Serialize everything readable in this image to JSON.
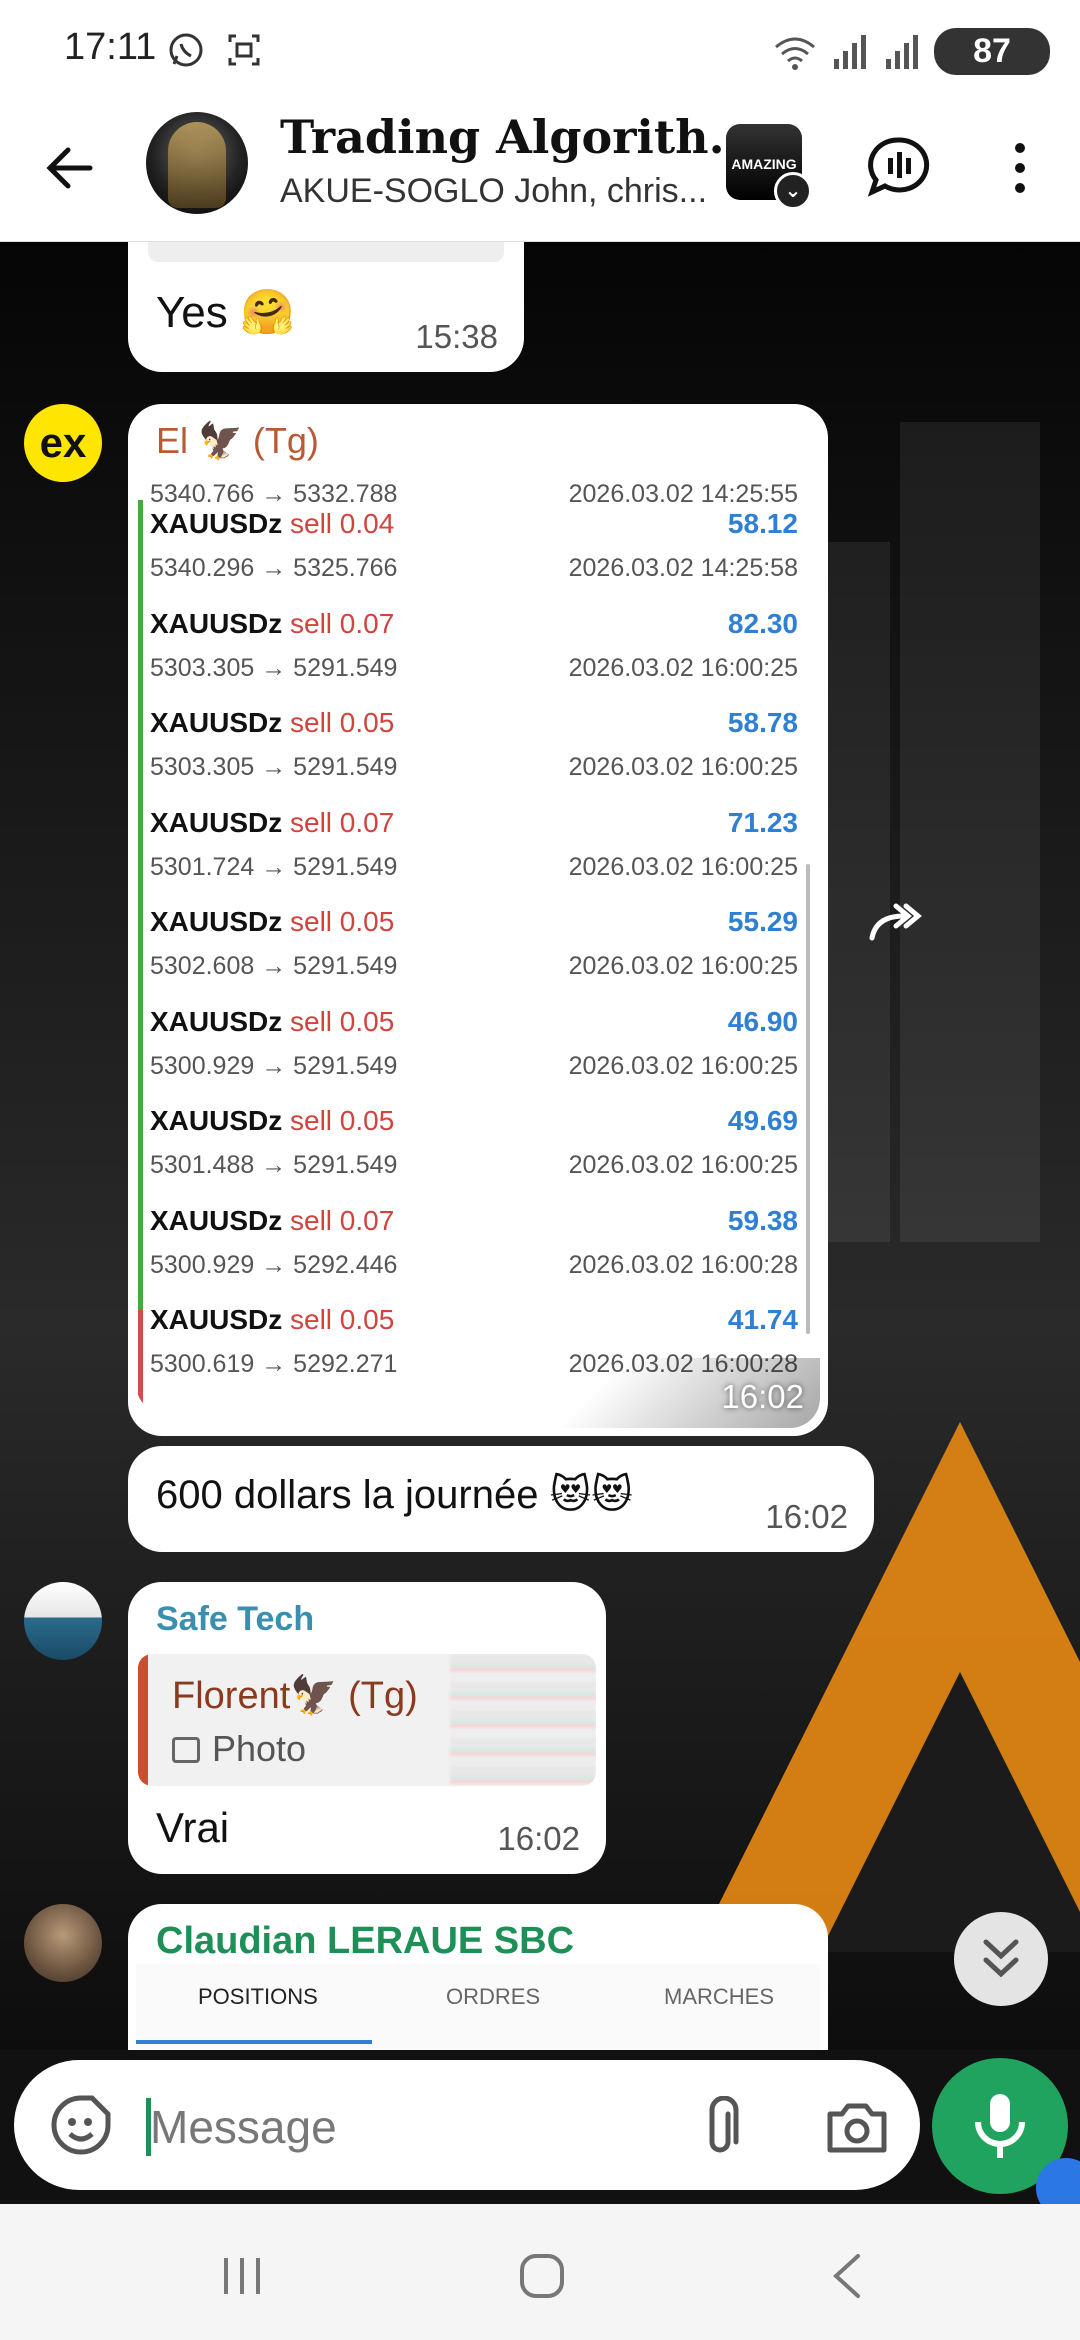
{
  "status_bar": {
    "time": "17:11",
    "icons_left": [
      "whatsapp-icon",
      "screenshot-icon"
    ],
    "icons_right": [
      "wifi-icon",
      "signal-icon",
      "signal-icon"
    ],
    "battery": "87"
  },
  "header": {
    "title": "Trading Algorith...",
    "subtitle": "AKUE-SOGLO John, chris...",
    "badge_label": "AMAZING"
  },
  "messages": [
    {
      "id": "m1",
      "text": "Yes 🤗",
      "time": "15:38"
    },
    {
      "id": "m2",
      "avatar_text": "ex",
      "sender": "El  🦅 (Tg)",
      "time": "16:02",
      "trades": [
        {
          "symbol": "",
          "side": "",
          "prices": "5340.766 → 5332.788",
          "profit": "",
          "date": "2026.03.02 14:25:55"
        },
        {
          "symbol": "XAUUSDz",
          "side": "sell 0.04",
          "prices": "5340.296 → 5325.766",
          "profit": "58.12",
          "date": "2026.03.02 14:25:58"
        },
        {
          "symbol": "XAUUSDz",
          "side": "sell 0.07",
          "prices": "5303.305 → 5291.549",
          "profit": "82.30",
          "date": "2026.03.02 16:00:25"
        },
        {
          "symbol": "XAUUSDz",
          "side": "sell 0.05",
          "prices": "5303.305 → 5291.549",
          "profit": "58.78",
          "date": "2026.03.02 16:00:25"
        },
        {
          "symbol": "XAUUSDz",
          "side": "sell 0.07",
          "prices": "5301.724 → 5291.549",
          "profit": "71.23",
          "date": "2026.03.02 16:00:25"
        },
        {
          "symbol": "XAUUSDz",
          "side": "sell 0.05",
          "prices": "5302.608 → 5291.549",
          "profit": "55.29",
          "date": "2026.03.02 16:00:25"
        },
        {
          "symbol": "XAUUSDz",
          "side": "sell 0.05",
          "prices": "5300.929 → 5291.549",
          "profit": "46.90",
          "date": "2026.03.02 16:00:25"
        },
        {
          "symbol": "XAUUSDz",
          "side": "sell 0.05",
          "prices": "5301.488 → 5291.549",
          "profit": "49.69",
          "date": "2026.03.02 16:00:25"
        },
        {
          "symbol": "XAUUSDz",
          "side": "sell 0.07",
          "prices": "5300.929 → 5292.446",
          "profit": "59.38",
          "date": "2026.03.02 16:00:28"
        },
        {
          "symbol": "XAUUSDz",
          "side": "sell 0.05",
          "prices": "5300.619 → 5292.271",
          "profit": "41.74",
          "date": "2026.03.02 16:00:28"
        }
      ]
    },
    {
      "id": "m3",
      "text": "600 dollars la journée 😻😻",
      "time": "16:02"
    },
    {
      "id": "m4",
      "sender": "Safe Tech",
      "reply_name": "Florent🦅 (Tg)",
      "reply_type": "Photo",
      "text": "Vrai",
      "time": "16:02"
    },
    {
      "id": "m5",
      "sender": "Claudian LERAUE SBC",
      "tabs": [
        "POSITIONS",
        "ORDRES",
        "MARCHES"
      ]
    }
  ],
  "input": {
    "placeholder": "Message"
  },
  "colors": {
    "accent_green": "#1fa35f",
    "profit_blue": "#2f7fd2",
    "sell_red": "#d3433d",
    "sender_orange": "#b85a36"
  }
}
